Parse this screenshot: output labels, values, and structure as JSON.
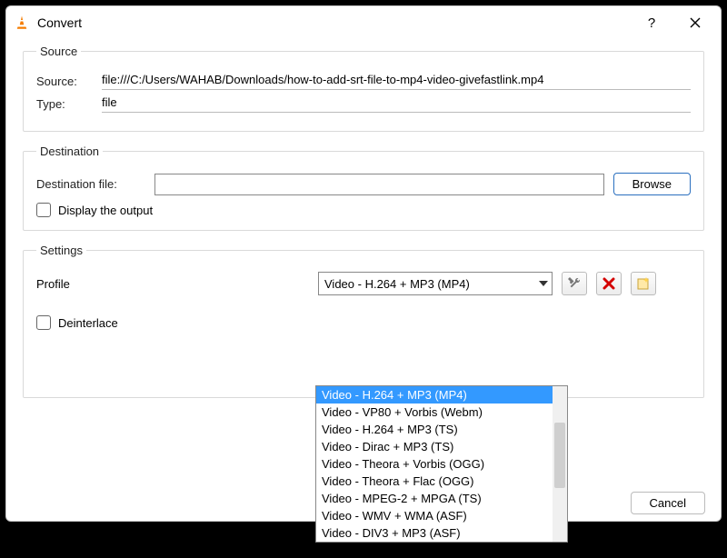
{
  "window": {
    "title": "Convert"
  },
  "source": {
    "legend": "Source",
    "source_label": "Source:",
    "source_value": "file:///C:/Users/WAHAB/Downloads/how-to-add-srt-file-to-mp4-video-givefastlink.mp4",
    "type_label": "Type:",
    "type_value": "file"
  },
  "destination": {
    "legend": "Destination",
    "file_label": "Destination file:",
    "file_value": "",
    "browse_label": "Browse",
    "display_output_label": "Display the output"
  },
  "settings": {
    "legend": "Settings",
    "profile_label": "Profile",
    "selected": "Video - H.264 + MP3 (MP4)",
    "options": [
      "Video - H.264 + MP3 (MP4)",
      "Video - VP80 + Vorbis (Webm)",
      "Video - H.264 + MP3 (TS)",
      "Video - Dirac + MP3 (TS)",
      "Video - Theora + Vorbis (OGG)",
      "Video - Theora + Flac (OGG)",
      "Video - MPEG-2 + MPGA (TS)",
      "Video - WMV + WMA (ASF)",
      "Video - DIV3 + MP3 (ASF)"
    ],
    "deinterlace_label": "Deinterlace",
    "tool_icon": "tools-icon",
    "delete_icon": "delete-icon",
    "new_icon": "new-profile-icon"
  },
  "buttons": {
    "cancel": "Cancel"
  }
}
